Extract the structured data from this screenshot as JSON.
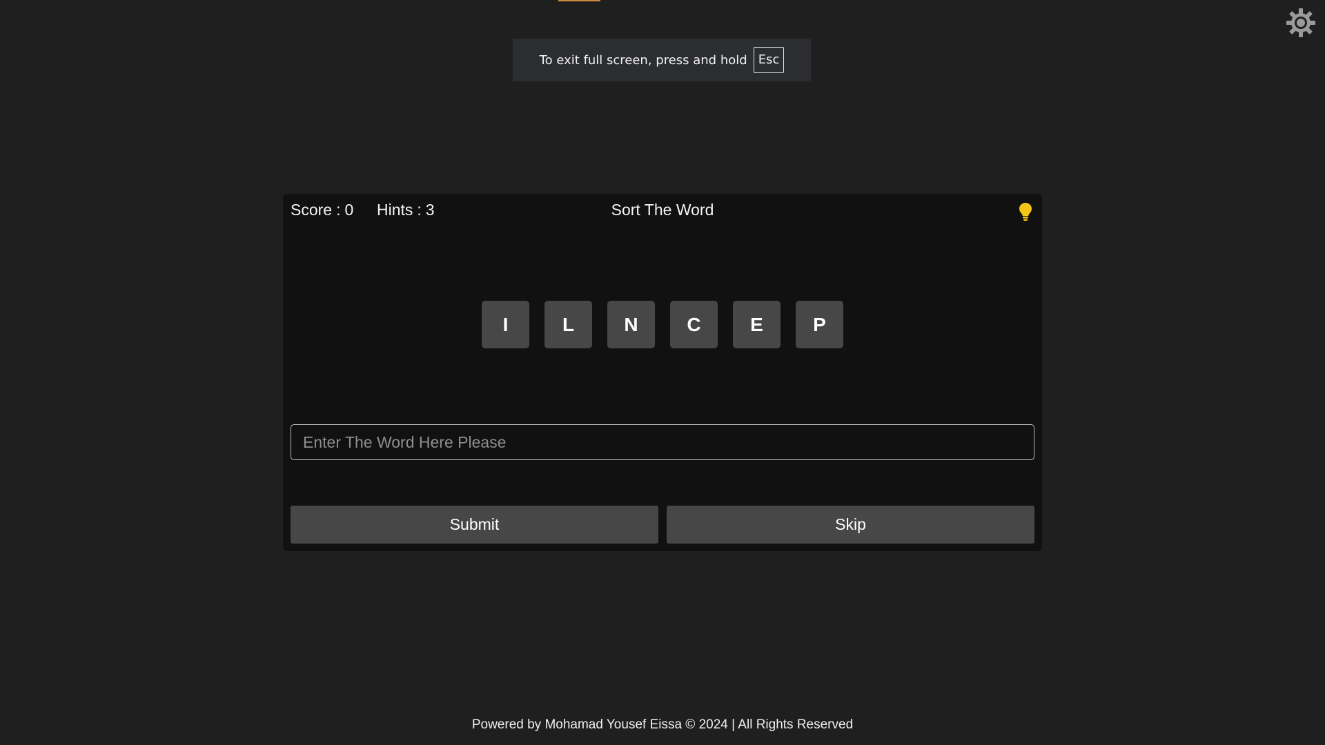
{
  "fullscreen_notice": {
    "text": "To exit full screen, press and hold",
    "key": "Esc"
  },
  "settings": {
    "icon": "gear-icon"
  },
  "game": {
    "score_label": "Score",
    "score_value": "0",
    "hints_label": "Hints",
    "hints_value": "3",
    "separator": ":",
    "title": "Sort The Word",
    "hint_icon": "lightbulb-icon",
    "hint_color": "#f5c518",
    "letters": [
      "I",
      "L",
      "N",
      "C",
      "E",
      "P"
    ],
    "input": {
      "placeholder": "Enter The Word Here Please",
      "value": ""
    },
    "submit_label": "Submit",
    "skip_label": "Skip"
  },
  "footer": {
    "text": "Powered by Mohamad Yousef Eissa © 2024 | All Rights Reserved"
  },
  "colors": {
    "background": "#1f1f1f",
    "card": "#111111",
    "tile": "#474747",
    "accent": "#c98a3c"
  }
}
